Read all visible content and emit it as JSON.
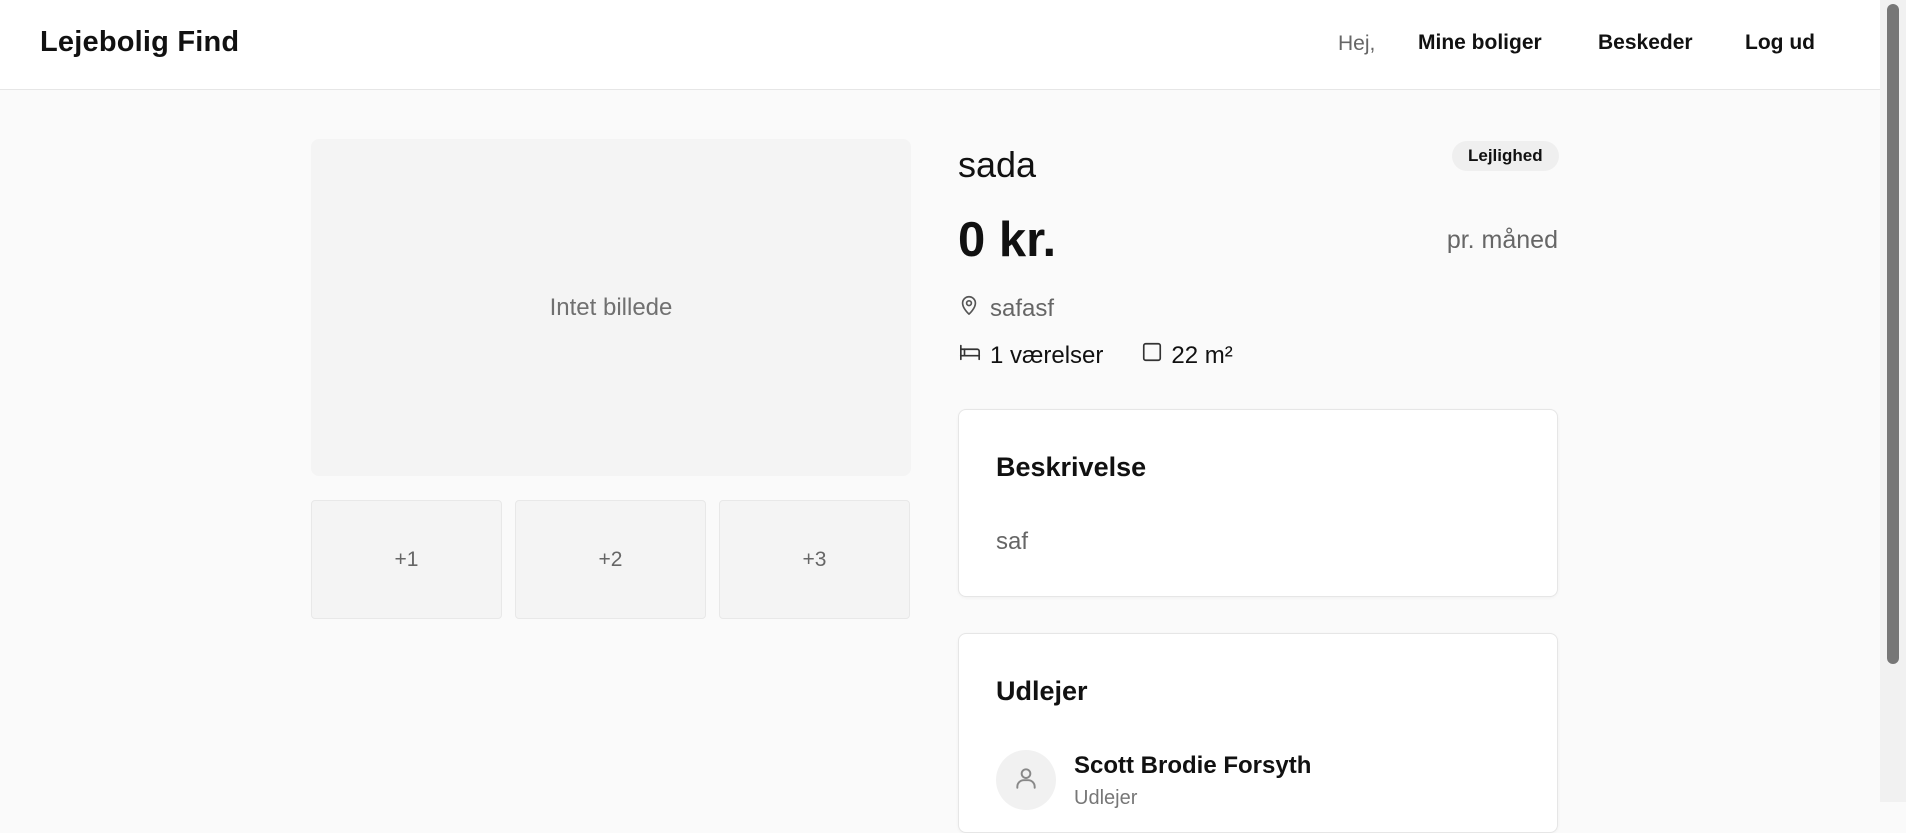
{
  "header": {
    "brand": "Lejebolig Find",
    "greeting": "Hej,",
    "nav": [
      "Mine boliger",
      "Beskeder",
      "Log ud"
    ]
  },
  "gallery": {
    "main_placeholder": "Intet billede",
    "thumbs": [
      "+1",
      "+2",
      "+3"
    ]
  },
  "listing": {
    "title": "sada",
    "type_badge": "Lejlighed",
    "price": "0 kr.",
    "price_unit": "pr. måned",
    "location": "safasf",
    "rooms": "1 værelser",
    "area": "22 m²"
  },
  "description": {
    "title": "Beskrivelse",
    "text": "saf"
  },
  "owner": {
    "title": "Udlejer",
    "name": "Scott Brodie Forsyth",
    "role": "Udlejer"
  },
  "icons": {
    "location": "map-pin-icon",
    "rooms": "bed-icon",
    "area": "square-icon",
    "avatar": "user-icon"
  }
}
